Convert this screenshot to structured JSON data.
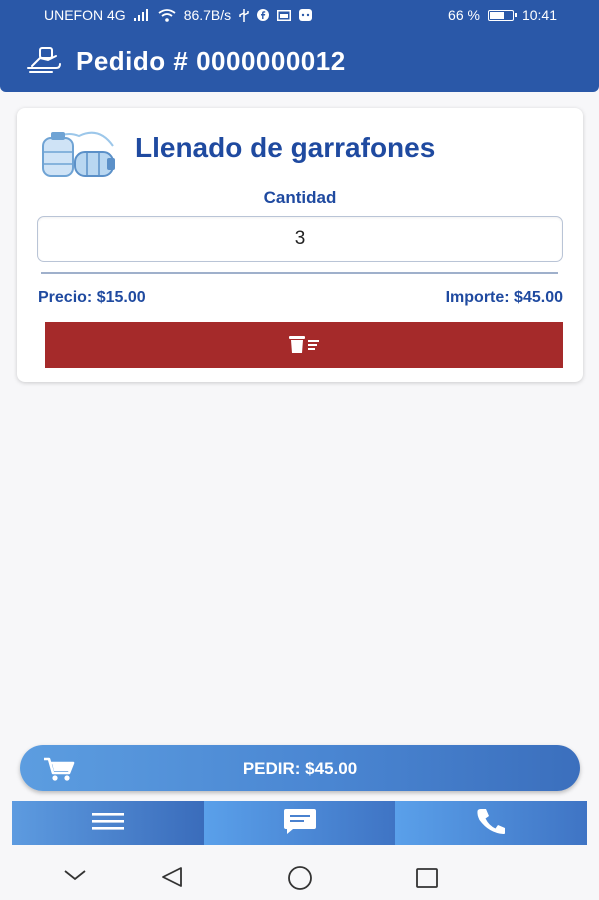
{
  "status_bar": {
    "carrier": "UNEFON 4G",
    "net_speed": "86.7B/s",
    "battery": "66 %",
    "battery_level": 0.66,
    "time": "10:41"
  },
  "header": {
    "icon": "water-jug-hand-icon",
    "title": "Pedido # 0000000012"
  },
  "item": {
    "image": "water-jugs-image",
    "name": "Llenado de garrafones",
    "quantity_label": "Cantidad",
    "quantity": "3",
    "price": "Precio: $15.00",
    "amount": "Importe: $45.00",
    "delete_icon": "trash-list-icon"
  },
  "order_button": {
    "icon": "cart-icon",
    "label": "PEDIR: $45.00"
  },
  "tabs": [
    {
      "icon": "menu-icon"
    },
    {
      "icon": "chat-icon"
    },
    {
      "icon": "phone-icon"
    }
  ],
  "colors": {
    "primary": "#2a58a8",
    "text_blue": "#1f4aa0",
    "danger": "#a52a2a",
    "button_gradient_start": "#5c9de0",
    "button_gradient_end": "#3b6fbd"
  }
}
